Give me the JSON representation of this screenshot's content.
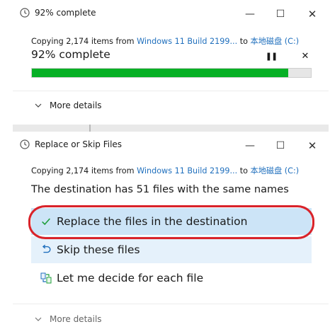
{
  "progress_dialog": {
    "title": "92% complete",
    "copy_prefix": "Copying 2,174 items from ",
    "source": "Windows 11 Build 2199...",
    "to_word": " to ",
    "destination": "本地磁盘 (C:)",
    "percent_text": "92% complete",
    "progress": 0.92,
    "pause_symbol": "❚❚",
    "cancel_symbol": "✕",
    "more_details": "More details"
  },
  "replace_dialog": {
    "title": "Replace or Skip Files",
    "copy_prefix": "Copying 2,174 items from ",
    "source": "Windows 11 Build 2199...",
    "to_word": " to ",
    "destination": "本地磁盘 (C:)",
    "message": "The destination has 51 files with the same names",
    "options": [
      {
        "label": "Replace the files in the destination",
        "icon": "checkmark-icon",
        "state": "hover"
      },
      {
        "label": "Skip these files",
        "icon": "skip-arrow-icon",
        "state": "selected"
      },
      {
        "label": "Let me decide for each file",
        "icon": "compare-files-icon",
        "state": "normal"
      }
    ],
    "more_details": "More details"
  },
  "window_controls": {
    "minimize": "—",
    "maximize": "☐",
    "close": "✕"
  },
  "colors": {
    "progress_fill": "#06b025",
    "link": "#1f6fbd",
    "option_hover": "#cce4f7",
    "option_selected": "#e5f1fb",
    "annotation": "#d9232a"
  }
}
